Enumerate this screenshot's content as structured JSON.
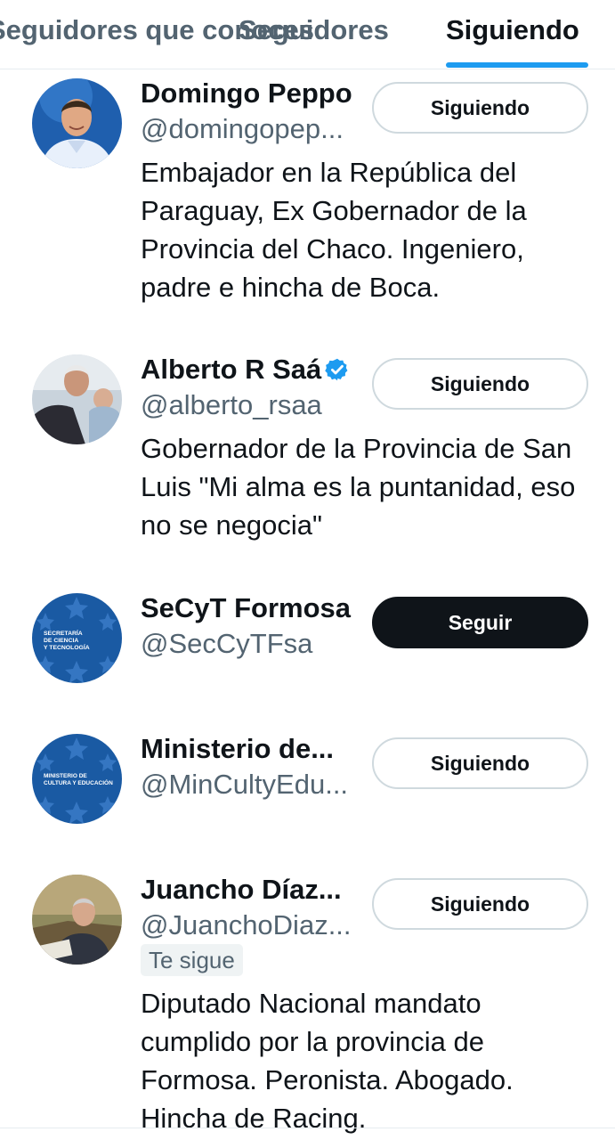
{
  "tabs": [
    {
      "label": "Seguidores que conoces"
    },
    {
      "label": "Seguidores"
    },
    {
      "label": "Siguiendo"
    }
  ],
  "accent_color": "#1d9bf0",
  "users": [
    {
      "name": "Domingo Peppo",
      "handle": "@domingopep...",
      "button": "Siguiendo",
      "bio": "Embajador en la República del Paraguay, Ex Gobernador de la Provincia del Chaco. Ingeniero, padre e hincha de Boca."
    },
    {
      "name": "Alberto R Saá",
      "verified": true,
      "handle": "@alberto_rsaa",
      "button": "Siguiendo",
      "bio": "Gobernador de la Provincia de San Luis \"Mi alma es la puntanidad, eso no se negocia\""
    },
    {
      "name": "SeCyT Formosa",
      "handle": "@SecCyTFsa",
      "button": "Seguir",
      "avatar_text": [
        "SECRETARÍA",
        "DE CIENCIA",
        "Y TECNOLOGÍA"
      ]
    },
    {
      "name": "Ministerio de...",
      "handle": "@MinCultyEdu...",
      "button": "Siguiendo",
      "avatar_text": [
        "MINISTERIO DE",
        "CULTURA Y EDUCACIÓN"
      ]
    },
    {
      "name": "Juancho Díaz...",
      "handle": "@JuanchoDiaz...",
      "button": "Siguiendo",
      "badge": "Te sigue",
      "bio": "Diputado Nacional mandato cumplido por la provincia de Formosa. Peronista. Abogado. Hincha de Racing."
    }
  ]
}
